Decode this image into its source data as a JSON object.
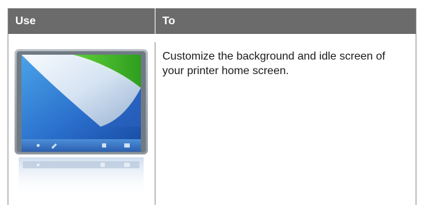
{
  "colors": {
    "header_bg": "#6b6b6b",
    "border": "#8a8a8a"
  },
  "table": {
    "columns": [
      "Use",
      "To"
    ],
    "rows": [
      {
        "use_icon": "background-and-idle-screen-icon",
        "to": "Customize the background and idle screen of your printer home screen."
      }
    ]
  }
}
